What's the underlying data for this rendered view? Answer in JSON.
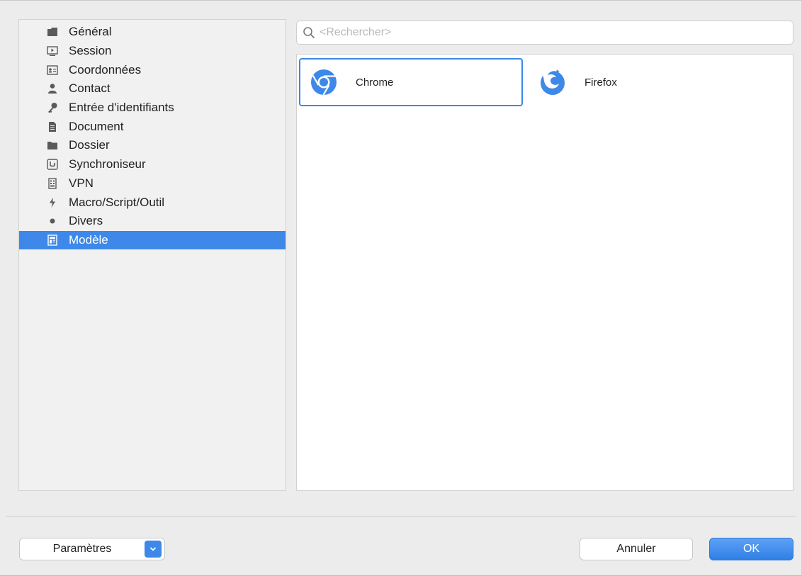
{
  "sidebar": {
    "items": [
      {
        "label": "Général",
        "icon": "general-icon",
        "selected": false
      },
      {
        "label": "Session",
        "icon": "session-icon",
        "selected": false
      },
      {
        "label": "Coordonnées",
        "icon": "coordinates-icon",
        "selected": false
      },
      {
        "label": "Contact",
        "icon": "contact-icon",
        "selected": false
      },
      {
        "label": "Entrée d'identifiants",
        "icon": "key-icon",
        "selected": false
      },
      {
        "label": "Document",
        "icon": "document-icon",
        "selected": false
      },
      {
        "label": "Dossier",
        "icon": "folder-icon",
        "selected": false
      },
      {
        "label": "Synchroniseur",
        "icon": "synchronizer-icon",
        "selected": false
      },
      {
        "label": "VPN",
        "icon": "vpn-icon",
        "selected": false
      },
      {
        "label": "Macro/Script/Outil",
        "icon": "lightning-icon",
        "selected": false
      },
      {
        "label": "Divers",
        "icon": "dot-icon",
        "selected": false
      },
      {
        "label": "Modèle",
        "icon": "template-icon",
        "selected": true
      }
    ]
  },
  "search": {
    "placeholder": "<Rechercher>",
    "value": ""
  },
  "content": {
    "tiles": [
      {
        "label": "Chrome",
        "icon": "chrome-icon",
        "selected": true
      },
      {
        "label": "Firefox",
        "icon": "firefox-icon",
        "selected": false
      }
    ]
  },
  "footer": {
    "params_label": "Paramètres",
    "cancel_label": "Annuler",
    "ok_label": "OK"
  },
  "colors": {
    "accent": "#3d88e8",
    "background": "#ececec"
  }
}
